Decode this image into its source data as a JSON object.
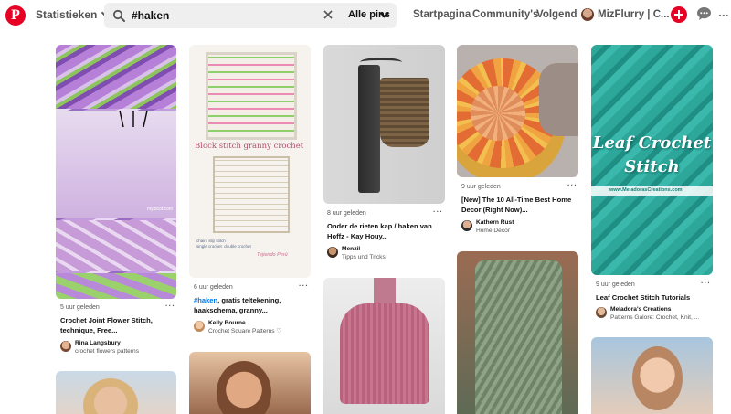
{
  "header": {
    "logo_letter": "P",
    "statistics_label": "Statistieken",
    "search_value": "#haken",
    "search_scope": "Alle pins",
    "nav_home": "Startpagina",
    "nav_community": "Community's",
    "nav_following": "Volgend",
    "user_name": "MizFlurry | C...",
    "more": "..."
  },
  "pins": [
    {
      "time": "5 uur geleden",
      "title": "Crochet Joint Flower Stitch, technique, Free...",
      "user": "Rina Langsbury",
      "subtitle": "crochet flowers patterns",
      "watermark": "mypicot.com",
      "more": "···"
    },
    {
      "time": "6 uur geleden",
      "title_tag": "#haken",
      "title_rest": ", gratis teltekening, haakschema, granny...",
      "user": "Kelly Bourne",
      "subtitle": "Crochet Square Patterns ♡",
      "overlay_title": "Block stitch granny",
      "overlay_title2": "crochet",
      "legend_chain": "chain",
      "legend_slip": "slip stitch",
      "legend_single": "single crochet",
      "legend_double": "double crochet",
      "credit": "Tejiendo Perú",
      "more": "···"
    },
    {
      "time": "8 uur geleden",
      "title": "Onder de rieten kap / haken van Hoffz - Kay Houy...",
      "user": "Menzil",
      "subtitle": "Tipps und Tricks",
      "more": "···"
    },
    {
      "time": "9 uur geleden",
      "title": "[New] The 10 All-Time Best Home Decor (Right Now)...",
      "user": "Kathern Rust",
      "subtitle": "Home Decor",
      "more": "···"
    },
    {
      "time": "9 uur geleden",
      "title": "Leaf Crochet Stitch Tutorials",
      "user": "Meladora's Creations",
      "subtitle": "Patterns Galore: Crochet, Knit, ...",
      "overlay_line1": "Leaf Crochet",
      "overlay_line2": "Stitch",
      "overlay_site": "www.MeladorasCreations.com",
      "more": "···"
    }
  ],
  "colors": {
    "brand_red": "#e60023",
    "link_blue": "#0074e8"
  }
}
